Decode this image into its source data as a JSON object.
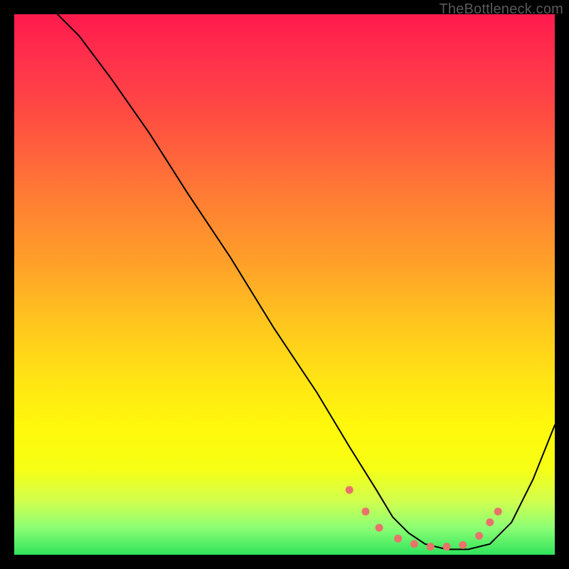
{
  "watermark": "TheBottleneck.com",
  "chart_data": {
    "type": "line",
    "title": "",
    "xlabel": "",
    "ylabel": "",
    "xlim": [
      0,
      100
    ],
    "ylim": [
      0,
      100
    ],
    "series": [
      {
        "name": "bottleneck-curve",
        "x": [
          8,
          12,
          18,
          25,
          32,
          40,
          48,
          56,
          62,
          67,
          70,
          73,
          76,
          80,
          84,
          88,
          92,
          96,
          100
        ],
        "y": [
          100,
          96,
          88,
          78,
          67,
          55,
          42,
          30,
          20,
          12,
          7,
          4,
          2,
          1,
          1,
          2,
          6,
          14,
          24
        ]
      }
    ],
    "markers": {
      "name": "highlight-dots",
      "color": "#e9736b",
      "x": [
        62,
        65,
        67.5,
        71,
        74,
        77,
        80,
        83,
        86,
        88,
        89.5
      ],
      "y": [
        12,
        8,
        5,
        3,
        2,
        1.5,
        1.5,
        1.8,
        3.5,
        6,
        8
      ]
    }
  }
}
